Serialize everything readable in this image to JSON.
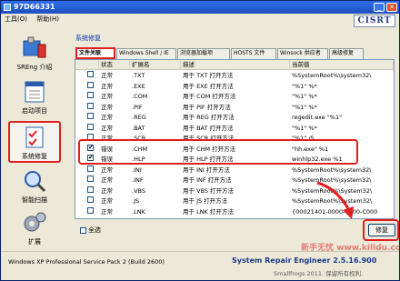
{
  "window": {
    "title": "97D66331",
    "close": "✕",
    "minimize": "_"
  },
  "menu": [
    "工具(O)",
    "帮助(H)"
  ],
  "logo": "CISRT",
  "sidebar": {
    "items": [
      {
        "label": "SREng 介绍",
        "icon": "tools-icon"
      },
      {
        "label": "启动项目",
        "icon": "calendar-icon"
      },
      {
        "label": "系统修复",
        "icon": "checklist-icon",
        "selected": true
      },
      {
        "label": "智能扫描",
        "icon": "magnifier-icon"
      },
      {
        "label": "扩展",
        "icon": "gears-icon"
      }
    ]
  },
  "group_label": "系统修复",
  "tabs": [
    "文件关联",
    "Windows Shell / IE",
    "浏览器加载项",
    "HOSTS 文件",
    "Winsock 供应者",
    "高级修复"
  ],
  "list": {
    "headers": [
      "状态",
      "扩展名",
      "描述",
      "当前值"
    ],
    "rows": [
      {
        "checked": false,
        "status": "正常",
        "ext": ".TXT",
        "desc": "用于 TXT 打开方法",
        "value": "%SystemRoot%\\system32\\"
      },
      {
        "checked": false,
        "status": "正常",
        "ext": ".EXE",
        "desc": "用于 EXE 打开方法",
        "value": "\"%1\" %*"
      },
      {
        "checked": false,
        "status": "正常",
        "ext": ".COM",
        "desc": "用于 COM 打开方法",
        "value": "\"%1\" %*"
      },
      {
        "checked": false,
        "status": "正常",
        "ext": ".PIF",
        "desc": "用于 PIF 打开方法",
        "value": "\"%1\" %*"
      },
      {
        "checked": false,
        "status": "正常",
        "ext": ".REG",
        "desc": "用于 REG 打开方法",
        "value": "regedit.exe \"%1\""
      },
      {
        "checked": false,
        "status": "正常",
        "ext": ".BAT",
        "desc": "用于 BAT 打开方法",
        "value": "\"%1\" %*"
      },
      {
        "checked": false,
        "status": "正常",
        "ext": ".SCR",
        "desc": "用于 SCR 打开方法",
        "value": "\"%1\" /S"
      },
      {
        "checked": true,
        "status": "错误",
        "ext": ".CHM",
        "desc": "用于 CHM 打开方法",
        "value": "\"hh.exe\" %1"
      },
      {
        "checked": true,
        "status": "错误",
        "ext": ".HLP",
        "desc": "用于 HLP 打开方法",
        "value": "winhlp32.exe %1"
      },
      {
        "checked": false,
        "status": "正常",
        "ext": ".INI",
        "desc": "用于 INI 打开方法",
        "value": "%SystemRoot%\\system32\\"
      },
      {
        "checked": false,
        "status": "正常",
        "ext": ".INF",
        "desc": "用于 INF 打开方法",
        "value": "%SystemRoot%\\system32\\"
      },
      {
        "checked": false,
        "status": "正常",
        "ext": ".VBS",
        "desc": "用于 VBS 打开方法",
        "value": "%SystemRoot%\\System32\\"
      },
      {
        "checked": false,
        "status": "正常",
        "ext": ".JS",
        "desc": "用于 JS 打开方法",
        "value": "%SystemRoot%\\System32\\"
      },
      {
        "checked": false,
        "status": "正常",
        "ext": ".LNK",
        "desc": "用于 LNK 打开方法",
        "value": "{00021401-0000-0000-C000"
      }
    ]
  },
  "select_all": "全选",
  "fix_button": "修复",
  "status": {
    "os": "Windows XP Professional Service Pack 2 (Build 2600)",
    "product": "System Repair Engineer 2.5.16.900",
    "copyright": "Smallfrogs 2011. 保留所有权利."
  },
  "watermark": "新手无忧 www.killdu.com",
  "colors": {
    "highlight": "#e02020",
    "title": "#2f6ee8"
  }
}
